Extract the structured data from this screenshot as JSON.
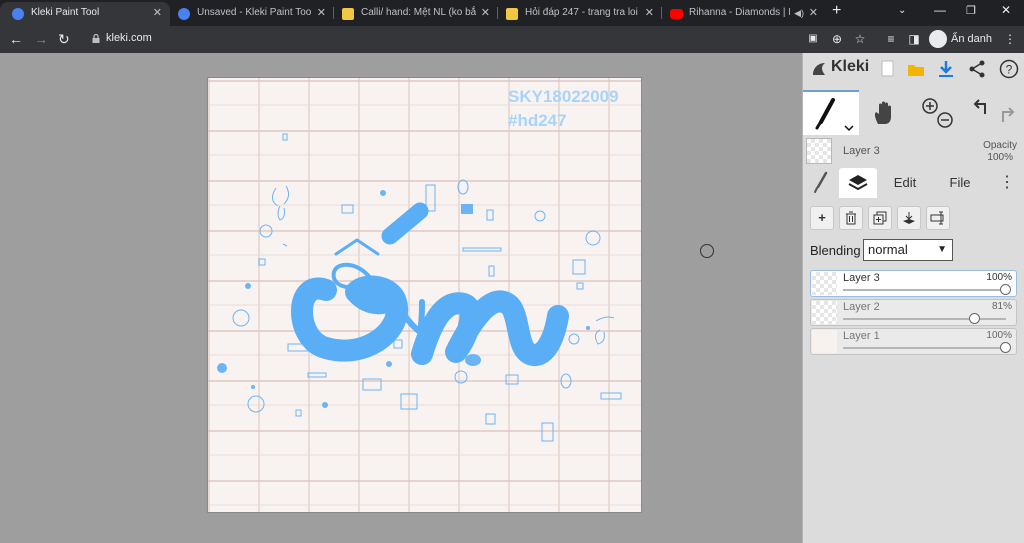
{
  "browser": {
    "tabs": [
      {
        "title": "Kleki Paint Tool",
        "active": true,
        "favicon": "kleki-icon"
      },
      {
        "title": "Unsaved - Kleki Paint Tool",
        "active": false,
        "favicon": "kleki-icon"
      },
      {
        "title": "Calli/ hand: Mệt NL (ko bắt b",
        "active": false,
        "favicon": "hoidap-icon"
      },
      {
        "title": "Hỏi đáp 247 - trang tra loi",
        "active": false,
        "favicon": "hoidap-icon"
      },
      {
        "title": "Rihanna - Diamonds | Ic",
        "active": false,
        "favicon": "youtube-icon"
      }
    ],
    "url": "kleki.com",
    "profile_label": "Ẩn danh"
  },
  "canvas": {
    "watermark_line1": "SKY18022009",
    "watermark_line2": "#hd247",
    "lettering": "ốm"
  },
  "panel": {
    "brand": "Kleki",
    "current_layer_name": "Layer 3",
    "opacity_label": "Opacity",
    "opacity_value": "100%",
    "tabs": {
      "edit": "Edit",
      "file": "File"
    },
    "blending_label": "Blending",
    "blending_value": "normal",
    "layers": [
      {
        "name": "Layer 3",
        "opacity": "100%",
        "opacity_fraction": 1.0,
        "active": true
      },
      {
        "name": "Layer 2",
        "opacity": "81%",
        "opacity_fraction": 0.81,
        "active": false
      },
      {
        "name": "Layer 1",
        "opacity": "100%",
        "opacity_fraction": 1.0,
        "active": false
      }
    ]
  },
  "colors": {
    "accent": "#5aaef5",
    "browser_dark": "#202124",
    "toolbar": "#35363a",
    "panel_bg": "#dcdcdc",
    "workspace_bg": "#9e9e9e"
  }
}
